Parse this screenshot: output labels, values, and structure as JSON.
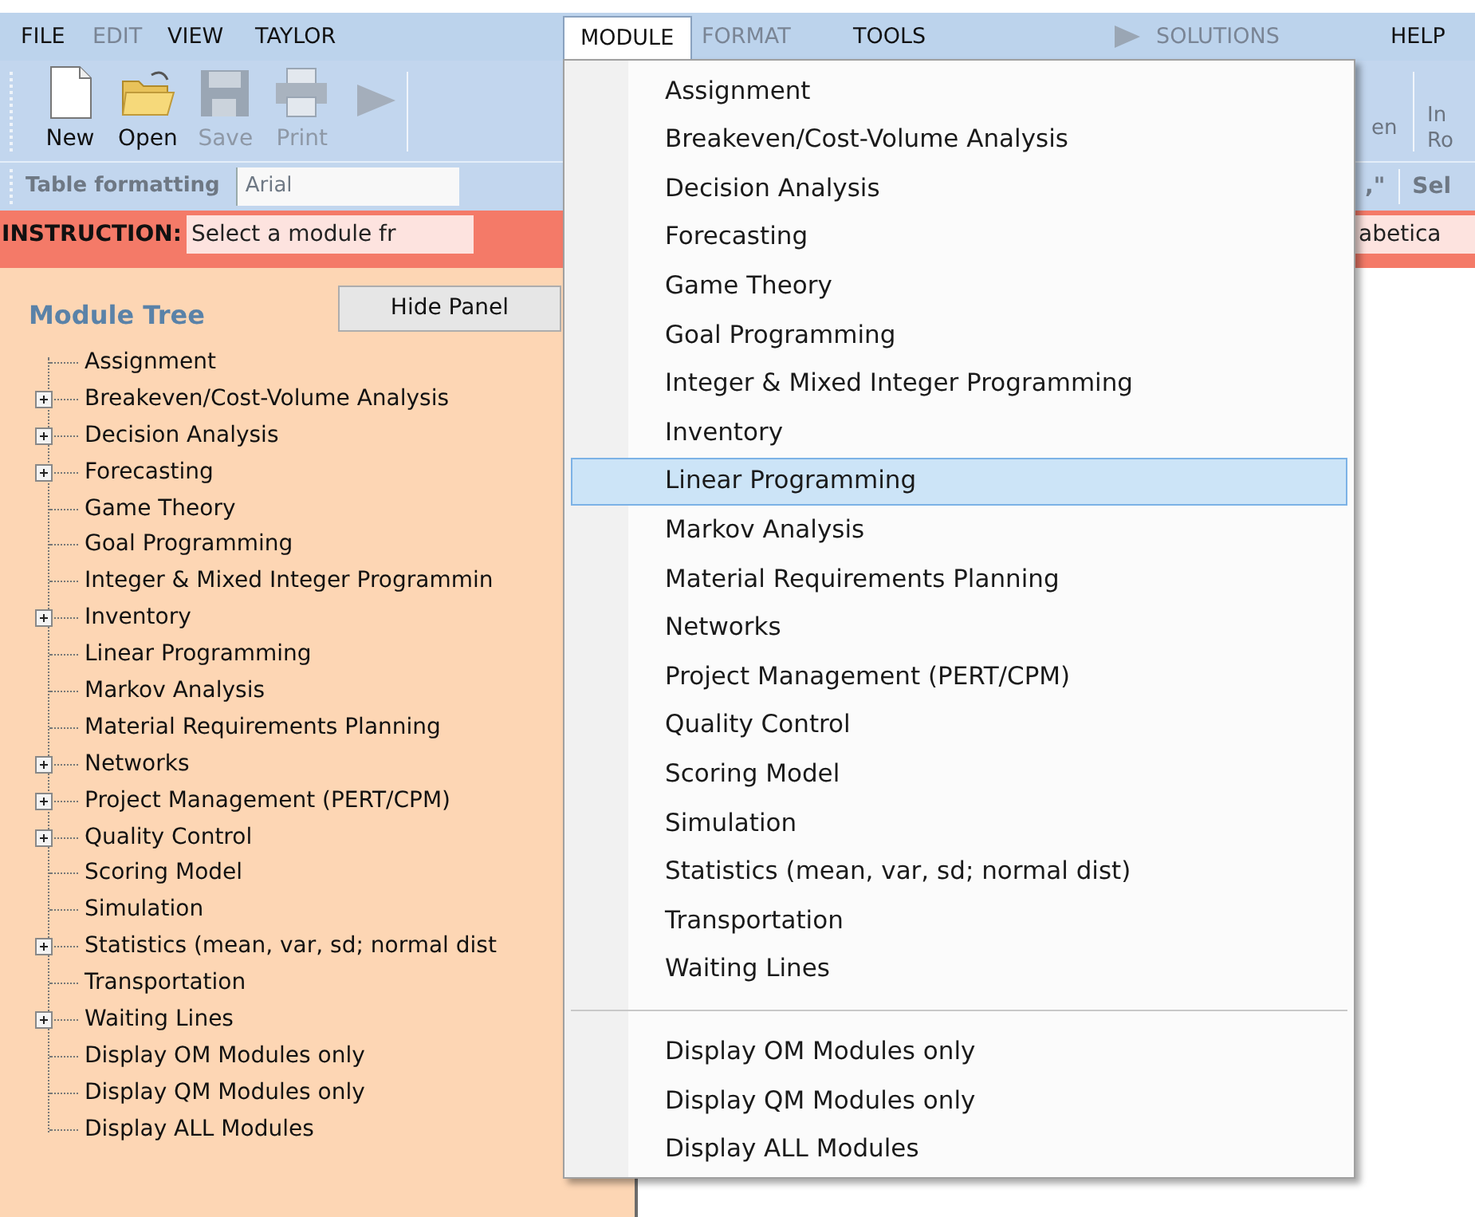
{
  "menu_bar": [
    {
      "label": "FILE",
      "disabled": false,
      "selected": false
    },
    {
      "label": "EDIT",
      "disabled": true,
      "selected": false
    },
    {
      "label": "VIEW",
      "disabled": false,
      "selected": false
    },
    {
      "label": "TAYLOR",
      "disabled": false,
      "selected": false
    },
    {
      "label": "MODULE",
      "disabled": false,
      "selected": true
    },
    {
      "label": "FORMAT",
      "disabled": true,
      "selected": false
    },
    {
      "label": "TOOLS",
      "disabled": false,
      "selected": false
    },
    {
      "label": "SOLUTIONS",
      "disabled": true,
      "selected": false,
      "kind": "run"
    },
    {
      "label": "HELP",
      "disabled": false,
      "selected": false
    }
  ],
  "toolbar": {
    "buttons": [
      {
        "label": "New",
        "kind": "new",
        "disabled": false
      },
      {
        "label": "Open",
        "kind": "open",
        "disabled": false
      },
      {
        "label": "Save",
        "kind": "save",
        "disabled": true
      },
      {
        "label": "Print",
        "kind": "print",
        "disabled": true
      }
    ],
    "right_fragments": [
      {
        "lines": [
          "en"
        ]
      },
      {
        "lines": [
          "In",
          "Ro"
        ]
      }
    ]
  },
  "format_bar": {
    "label": "Table formatting",
    "font_field": "Arial",
    "right_fragments": [
      ",\"",
      "Sel"
    ]
  },
  "instruction": {
    "label": "INSTRUCTION:",
    "text": "Select a module fr",
    "text_end": "abetica"
  },
  "module_tree": {
    "title": "Module Tree",
    "hide_button": "Hide Panel",
    "items": [
      {
        "label": "Assignment",
        "kind": "leaf"
      },
      {
        "label": "Breakeven/Cost-Volume Analysis",
        "kind": "group"
      },
      {
        "label": "Decision Analysis",
        "kind": "group"
      },
      {
        "label": "Forecasting",
        "kind": "group"
      },
      {
        "label": "Game Theory",
        "kind": "leaf"
      },
      {
        "label": "Goal Programming",
        "kind": "leaf"
      },
      {
        "label": "Integer & Mixed Integer Programmin",
        "kind": "leaf"
      },
      {
        "label": "Inventory",
        "kind": "group"
      },
      {
        "label": "Linear Programming",
        "kind": "leaf"
      },
      {
        "label": "Markov Analysis",
        "kind": "leaf"
      },
      {
        "label": "Material Requirements Planning",
        "kind": "leaf"
      },
      {
        "label": "Networks",
        "kind": "group"
      },
      {
        "label": "Project Management (PERT/CPM)",
        "kind": "group"
      },
      {
        "label": "Quality Control",
        "kind": "group"
      },
      {
        "label": "Scoring Model",
        "kind": "leaf"
      },
      {
        "label": "Simulation",
        "kind": "leaf"
      },
      {
        "label": "Statistics (mean, var, sd; normal dist",
        "kind": "group"
      },
      {
        "label": "Transportation",
        "kind": "leaf"
      },
      {
        "label": "Waiting Lines",
        "kind": "group"
      },
      {
        "label": "Display OM Modules only",
        "kind": "leaf"
      },
      {
        "label": "Display QM Modules only",
        "kind": "leaf"
      },
      {
        "label": "Display ALL Modules",
        "kind": "leaf"
      }
    ]
  },
  "module_menu": {
    "groups": [
      [
        {
          "label": "Assignment",
          "selected": false
        },
        {
          "label": "Breakeven/Cost-Volume Analysis",
          "selected": false
        },
        {
          "label": "Decision Analysis",
          "selected": false
        },
        {
          "label": "Forecasting",
          "selected": false
        },
        {
          "label": "Game Theory",
          "selected": false
        },
        {
          "label": "Goal Programming",
          "selected": false
        },
        {
          "label": "Integer & Mixed Integer Programming",
          "selected": false
        },
        {
          "label": "Inventory",
          "selected": false
        },
        {
          "label": "Linear Programming",
          "selected": true
        },
        {
          "label": "Markov Analysis",
          "selected": false
        },
        {
          "label": "Material Requirements Planning",
          "selected": false
        },
        {
          "label": "Networks",
          "selected": false
        },
        {
          "label": "Project Management (PERT/CPM)",
          "selected": false
        },
        {
          "label": "Quality Control",
          "selected": false
        },
        {
          "label": "Scoring Model",
          "selected": false
        },
        {
          "label": "Simulation",
          "selected": false
        },
        {
          "label": "Statistics (mean, var, sd; normal dist)",
          "selected": false
        },
        {
          "label": "Transportation",
          "selected": false
        },
        {
          "label": "Waiting Lines",
          "selected": false
        }
      ],
      [
        {
          "label": "Display OM Modules only",
          "selected": false
        },
        {
          "label": "Display QM Modules only",
          "selected": false
        },
        {
          "label": "Display ALL Modules",
          "selected": false
        }
      ]
    ]
  }
}
